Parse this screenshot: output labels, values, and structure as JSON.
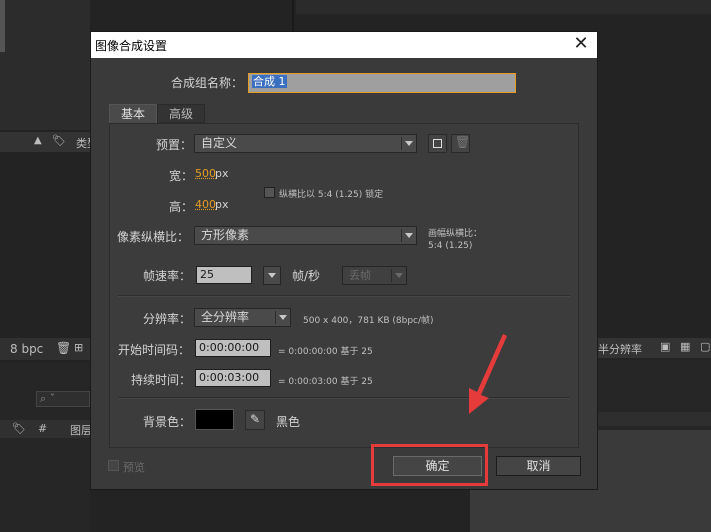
{
  "background": {
    "bpc_label": "8 bpc",
    "search_placeholder": "⌕ ˇ",
    "type_label": "类型",
    "hash_label": "#",
    "layer_label": "图层",
    "scale_label": "半分辨率"
  },
  "dialog": {
    "title": "图像合成设置",
    "close_glyph": "✕",
    "comp_name_label": "合成组名称：",
    "comp_name_value": "合成 1",
    "tabs": [
      {
        "label": "基本",
        "active": true
      },
      {
        "label": "高级",
        "active": false
      }
    ],
    "preset": {
      "label": "预置：",
      "value": "自定义"
    },
    "width": {
      "label": "宽：",
      "value": "500",
      "unit": "px"
    },
    "height": {
      "label": "高：",
      "value": "400",
      "unit": "px"
    },
    "lock_aspect": {
      "label": "纵横比以 5:4 (1.25) 锁定",
      "checked": false
    },
    "pixel_aspect": {
      "label": "像素纵横比：",
      "value": "方形像素"
    },
    "frame_aspect": {
      "label": "画幅纵横比：",
      "value": "5:4 (1.25)"
    },
    "frame_rate": {
      "label": "帧速率：",
      "value": "25",
      "unit": "帧/秒",
      "drop_value": "丢帧"
    },
    "resolution": {
      "label": "分辨率：",
      "value": "全分辨率",
      "info": "500 x 400，781 KB (8bpc/帧)"
    },
    "start_timecode": {
      "label": "开始时间码：",
      "value": "0:00:00:00",
      "info": "= 0:00:00:00  基于 25"
    },
    "duration": {
      "label": "持续时间：",
      "value": "0:00:03:00",
      "info": "= 0:00:03:00  基于 25"
    },
    "bg_color": {
      "label": "背景色：",
      "name": "黑色",
      "hex": "#000000"
    },
    "preview": {
      "label": "预览",
      "checked": false
    },
    "ok_label": "确定",
    "cancel_label": "取消"
  },
  "colors": {
    "accent_orange": "#e59c22",
    "annotation_red": "#e53b3b",
    "name_highlight": "#3b6fbf"
  }
}
